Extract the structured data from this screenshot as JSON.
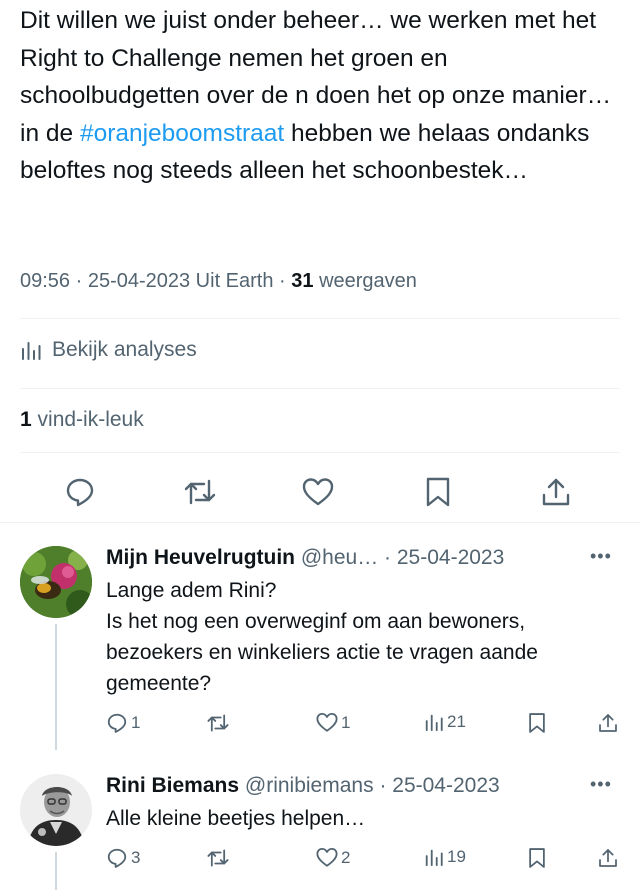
{
  "tweet": {
    "text_before": "Dit willen we juist onder beheer… we werken met het Right to Challenge nemen het groen en schoolbudgetten over de n doen het op onze manier… in de ",
    "hashtag": "#oranjeboomstraat",
    "text_after": " hebben we helaas ondanks beloftes nog steeds alleen het schoonbestek…",
    "meta": "09:56 · 25-04-2023 Uit Earth · ",
    "views_count": "31",
    "views_label": " weergaven",
    "analytics_label": "Bekijk analyses",
    "likes_count": "1",
    "likes_label": " vind-ik-leuk"
  },
  "replies": [
    {
      "name": "Mijn Heuvelrugtuin",
      "handle": "@heu…",
      "date": "· 25-04-2023",
      "text": "Lange adem Rini?\nIs het nog een overweginf om aan  bewoners, bezoekers en winkeliers actie te vragen aande gemeente?",
      "reply_count": "1",
      "retweet_count": "",
      "like_count": "1",
      "view_count": "21"
    },
    {
      "name": "Rini Biemans",
      "handle": "@rinibiemans",
      "date": "· 25-04-2023",
      "text": "Alle kleine beetjes helpen…",
      "reply_count": "3",
      "retweet_count": "",
      "like_count": "2",
      "view_count": "19"
    }
  ],
  "icons": [
    "reply-icon",
    "retweet-icon",
    "like-icon",
    "bookmark-icon",
    "share-icon",
    "analytics-icon",
    "more-icon"
  ],
  "colors": {
    "link": "#1d9bf0",
    "secondary": "#536471",
    "text": "#0f1419",
    "divider": "#eff3f4"
  }
}
